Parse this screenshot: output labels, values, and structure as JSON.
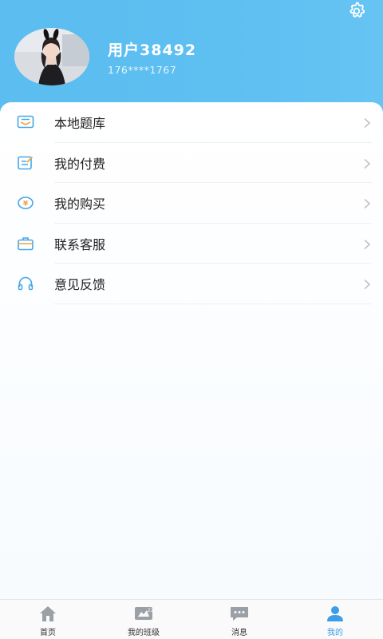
{
  "profile": {
    "username": "用户38492",
    "phone": "176****1767"
  },
  "header": {
    "settings_icon": "gear-icon"
  },
  "menu": {
    "items": [
      {
        "label": "本地题库",
        "icon": "question-bank-icon"
      },
      {
        "label": "我的付费",
        "icon": "edit-note-icon"
      },
      {
        "label": "我的购买",
        "icon": "yen-coin-icon"
      },
      {
        "label": "联系客服",
        "icon": "briefcase-icon"
      },
      {
        "label": "意见反馈",
        "icon": "headphones-icon"
      }
    ]
  },
  "tabbar": {
    "items": [
      {
        "label": "首页",
        "icon": "home-icon",
        "active": false
      },
      {
        "label": "我的班级",
        "icon": "class-icon",
        "active": false
      },
      {
        "label": "消息",
        "icon": "message-icon",
        "active": false
      },
      {
        "label": "我的",
        "icon": "person-icon",
        "active": true
      }
    ]
  },
  "colors": {
    "header": "#5ebff1",
    "accent": "#3d9ee8",
    "icon_blue": "#45a7e8",
    "icon_orange": "#f2a33a"
  }
}
